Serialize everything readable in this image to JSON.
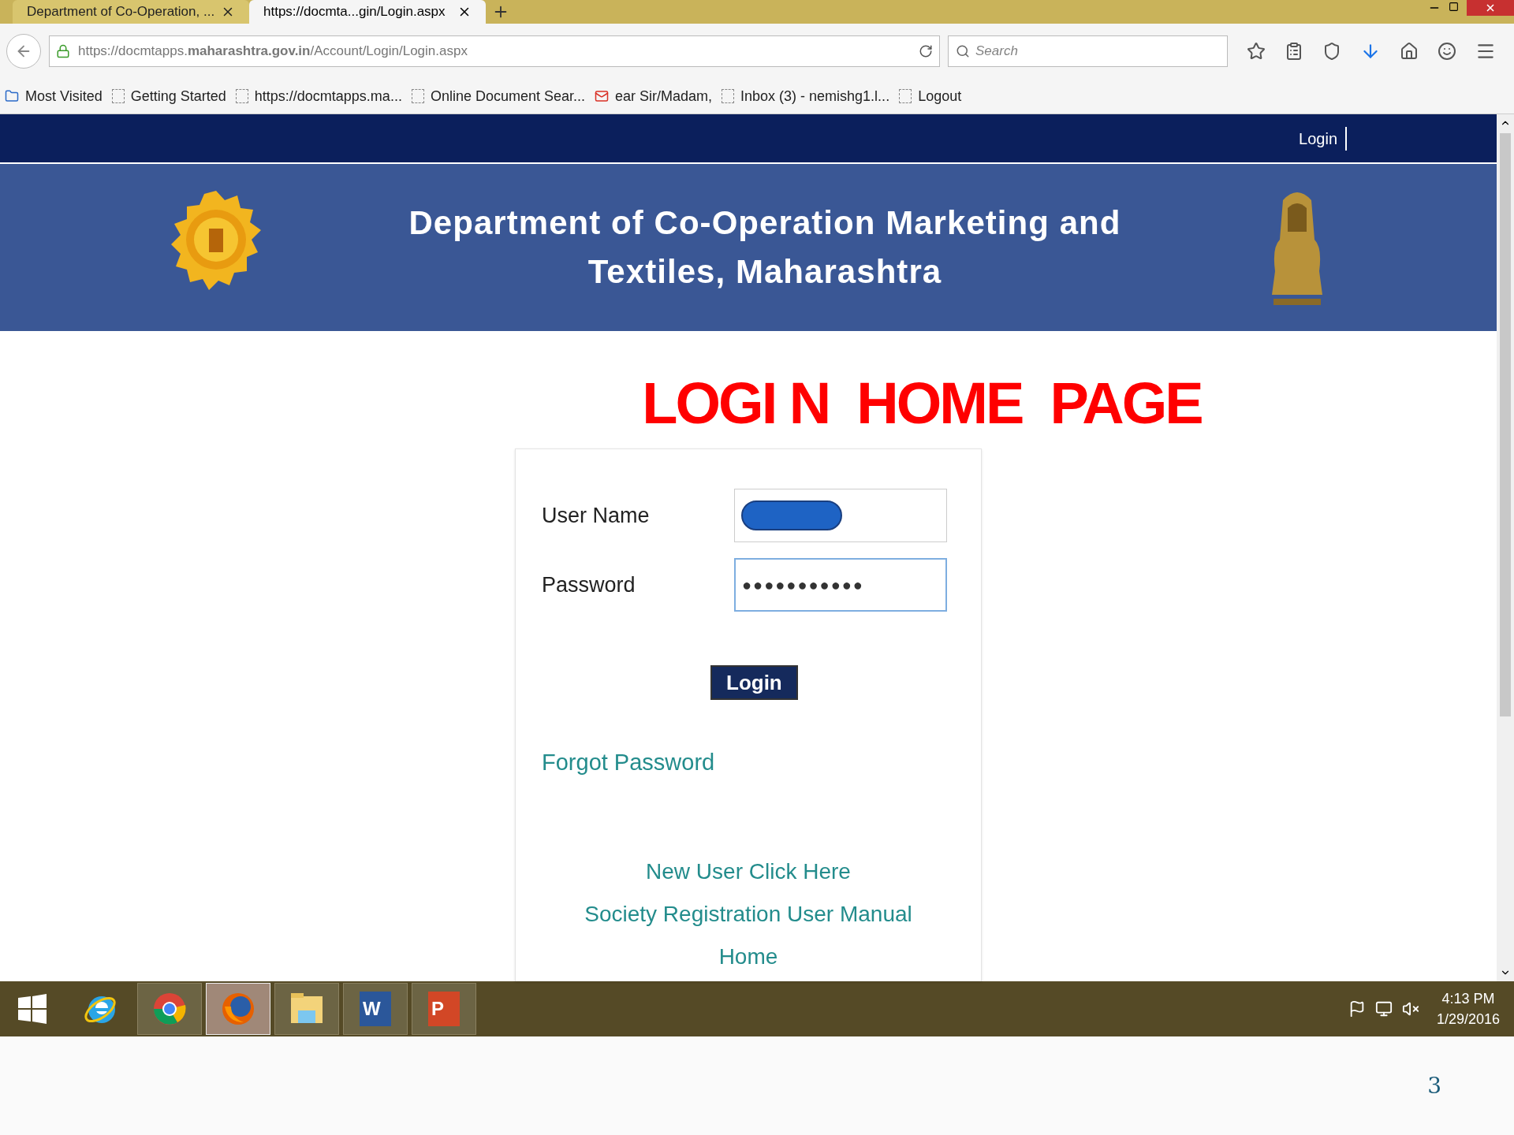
{
  "browser": {
    "tabs": [
      {
        "title": "Department of Co-Operation, ...",
        "selected": false
      },
      {
        "title": "https://docmta...gin/Login.aspx",
        "selected": true
      }
    ],
    "url": "https://docmtapps.**maharashtra.gov.in**/Account/Login/Login.aspx",
    "search": {
      "placeholder": "Search"
    },
    "bookmarks": [
      {
        "label": "Most Visited",
        "kind": "folder"
      },
      {
        "label": "Getting Started",
        "kind": "page"
      },
      {
        "label": "https://docmtapps.ma...",
        "kind": "page"
      },
      {
        "label": "Online Document Sear...",
        "kind": "page"
      },
      {
        "label": "ear Sir/Madam,",
        "kind": "mail"
      },
      {
        "label": "Inbox (3) - nemishg1.l...",
        "kind": "page"
      },
      {
        "label": "Logout",
        "kind": "page"
      }
    ]
  },
  "site": {
    "nav_link": "Login",
    "title_lines": [
      "Department of Co-Operation Marketing and",
      "Textiles, Maharashtra"
    ]
  },
  "overlay_heading": "LOGI N  HOME  PAGE",
  "form": {
    "fields": [
      {
        "label": "User Name",
        "kind": "redacted",
        "focused": false
      },
      {
        "label": "Password",
        "kind": "password",
        "value": "●●●●●●●●●●●",
        "focused": true
      }
    ],
    "button": "Login",
    "forgot_link": "Forgot Password",
    "links": [
      "New User Click Here",
      "Society Registration User Manual",
      "Home"
    ]
  },
  "taskbar": {
    "apps": [
      {
        "kind": "windows",
        "selected": false
      },
      {
        "kind": "ie",
        "selected": false
      },
      {
        "kind": "chrome",
        "selected": false
      },
      {
        "kind": "firefox",
        "selected": true
      },
      {
        "kind": "explorer",
        "selected": false
      },
      {
        "kind": "word",
        "glyph": "W",
        "selected": false
      },
      {
        "kind": "powerpoint",
        "glyph": "P",
        "selected": false
      }
    ],
    "time": "4:13 PM",
    "date": "1/29/2016"
  },
  "slide_number": "3"
}
